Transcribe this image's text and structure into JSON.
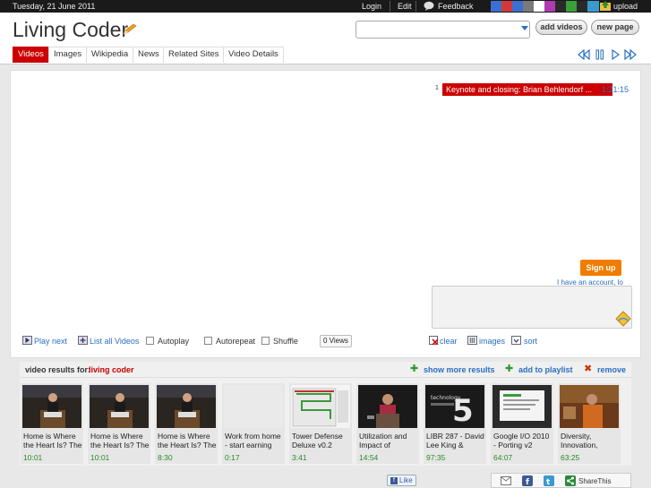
{
  "topbar": {
    "date": "Tuesday, 21 June 2011",
    "login": "Login",
    "edit": "Edit",
    "feedback": "Feedback",
    "upload": "upload",
    "swatches": [
      "#3b6fd1",
      "#d23a3a",
      "#3b6fd1",
      "#7a7a7a",
      "#ffffff",
      "#b03ab0",
      "#2a2a2a",
      "#3aa03a",
      "#2a2a2a",
      "#3a9ad0"
    ]
  },
  "header": {
    "logo": "Living Coder",
    "search_value": "",
    "add_videos": "add videos",
    "new_page": "new page"
  },
  "tabs": [
    "Videos",
    "Images",
    "Wikipedia",
    "News",
    "Related Sites",
    "Video Details"
  ],
  "player": {
    "playlist_num": "1",
    "playlist_title": "Keynote and closing: Brian Behlendorf ...",
    "playlist_time": "1:21:15"
  },
  "controls": {
    "play_next": "Play next",
    "list_all": "List all Videos",
    "autoplay": "Autoplay",
    "autorepeat": "Autorepeat",
    "shuffle": "Shuffle",
    "views": "0 Views",
    "clear": "clear",
    "images": "images",
    "sort": "sort",
    "signup": "Sign up",
    "account": "I have an account, lo"
  },
  "results": {
    "label": "video results for:",
    "term": "living coder",
    "show_more": "show more results",
    "add_playlist": "add to playlist",
    "remove": "remove",
    "videos": [
      {
        "title": "Home is Where the Heart Is? The",
        "duration": "10:01"
      },
      {
        "title": "Home is Where the Heart Is? The",
        "duration": "10:01"
      },
      {
        "title": "Home is Where the Heart Is? The",
        "duration": "8:30"
      },
      {
        "title": "Work from home - start earning",
        "duration": "0:17"
      },
      {
        "title": "Tower Defense Deluxe v0.2",
        "duration": "3:41"
      },
      {
        "title": "Utilization and Impact of",
        "duration": "14:54"
      },
      {
        "title": "LIBR 287 - David Lee King &",
        "duration": "97:35"
      },
      {
        "title": "Google I/O 2010 - Porting v2",
        "duration": "64:07"
      },
      {
        "title": "Diversity, Innovation,",
        "duration": "63:25"
      }
    ]
  },
  "footer": {
    "like": "Like",
    "share": "ShareThis"
  }
}
